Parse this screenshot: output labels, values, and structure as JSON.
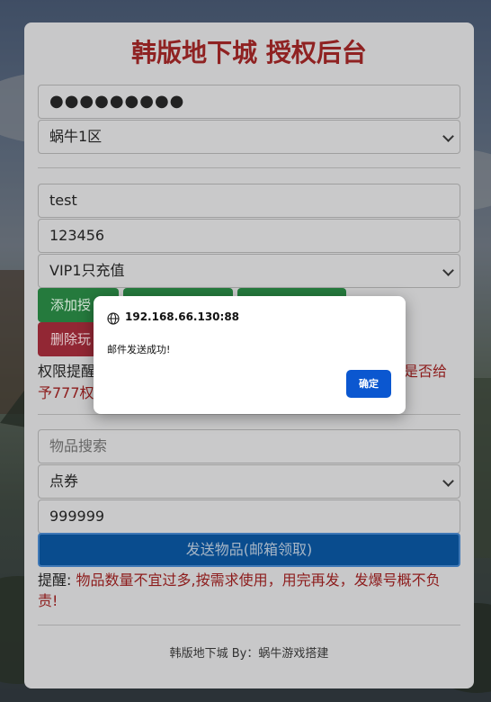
{
  "page": {
    "title": "韩版地下城 授权后台"
  },
  "login": {
    "password_value": "●●●●●●●●●",
    "server_selected": "蜗牛1区"
  },
  "player": {
    "account_value": "test",
    "role_value": "123456",
    "vip_selected": "VIP1只充值"
  },
  "buttons": {
    "add_auth": "添加授",
    "delete_player": "删除玩"
  },
  "permission_notice": {
    "line1_prefix": "权限提醒",
    "line1_suffix": "是否给",
    "line2_prefix": "予777权"
  },
  "items": {
    "search_placeholder": "物品搜索",
    "currency_selected": "点券",
    "quantity_value": "999999",
    "send_label": "发送物品(邮箱领取)"
  },
  "notice": {
    "label": "提醒:",
    "text": "物品数量不宜过多,按需求使用，用完再发，发爆号概不负责!"
  },
  "footer": {
    "text": "韩版地下城 By：蜗牛游戏搭建"
  },
  "dialog": {
    "host": "192.168.66.130:88",
    "message": "邮件发送成功!",
    "ok_label": "确定"
  },
  "colors": {
    "title_red": "#8f2222",
    "primary_blue": "#0b57d0",
    "success_green": "#257a3d",
    "danger_red": "#922734"
  }
}
